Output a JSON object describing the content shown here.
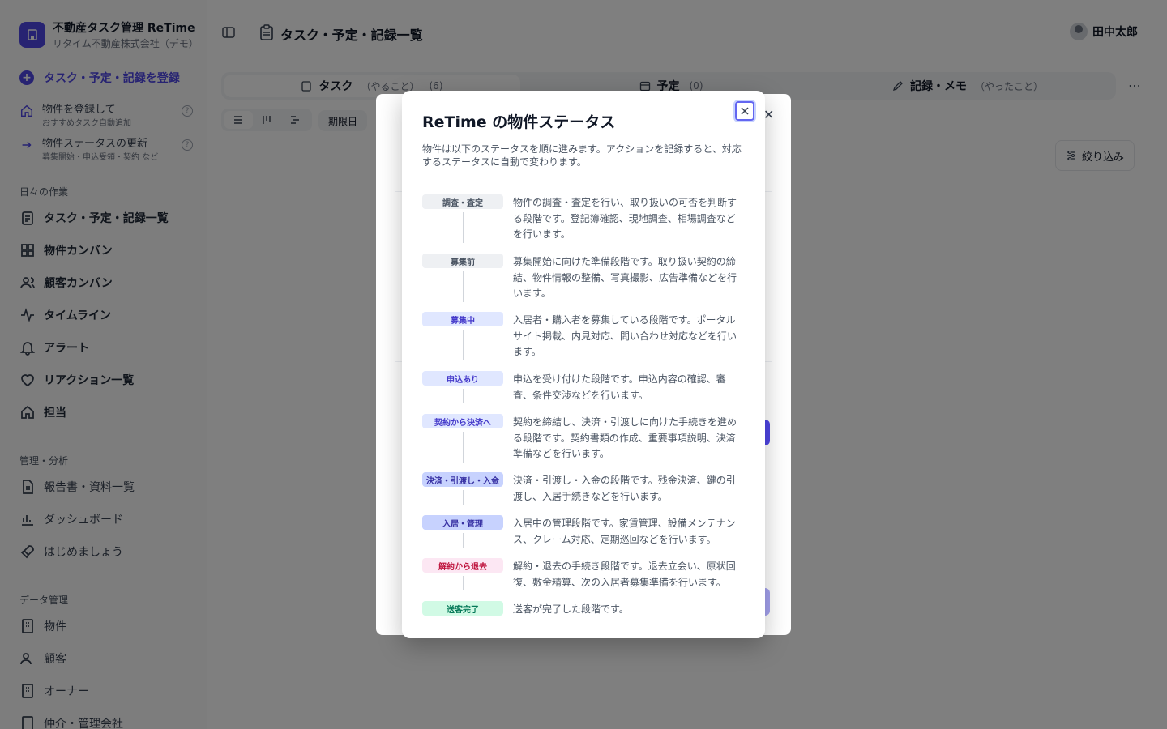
{
  "sidebar": {
    "brand_name": "不動産タスク管理 ReTime",
    "company": "リタイム不動産株式会社（デモ）",
    "primary_action": "タスク・予定・記録を登録",
    "quick_actions": [
      {
        "title": "物件を登録して",
        "sub": "おすすめタスク自動追加"
      },
      {
        "title": "物件ステータスの更新",
        "sub": "募集開始・申込受領・契約 など"
      }
    ],
    "daily_label": "日々の作業",
    "daily_items": [
      "タスク・予定・記録一覧",
      "物件カンバン",
      "顧客カンバン",
      "タイムライン",
      "アラート",
      "リアクション一覧",
      "担当"
    ],
    "analysis_label": "管理・分析",
    "analysis_items": [
      "報告書・資料一覧",
      "ダッシュボード",
      "はじめましょう"
    ],
    "data_label": "データ管理",
    "data_items": [
      "物件",
      "顧客",
      "オーナー",
      "仲介・管理会社"
    ]
  },
  "header": {
    "title": "タスク・予定・記録一覧",
    "user_name": "田中太郎"
  },
  "tabs": [
    {
      "label": "タスク",
      "sub": "（やること）",
      "count": "(6)"
    },
    {
      "label": "予定",
      "sub": "",
      "count": "(0)"
    },
    {
      "label": "記録・メモ",
      "sub": "（やったこと）",
      "count": ""
    }
  ],
  "toolbar": {
    "sort_label": "期限日",
    "filter_label": "絞り込み"
  },
  "modal": {
    "title": "ReTime の物件ステータス",
    "description": "物件は以下のステータスを順に進みます。アクションを記録すると、対応するステータスに自動で変わります。",
    "statuses": [
      {
        "label": "調査・査定",
        "desc": "物件の調査・査定を行い、取り扱いの可否を判断する段階です。登記簿確認、現地調査、相場調査などを行います。",
        "bg": "#eef0f3",
        "fg": "#4b5563"
      },
      {
        "label": "募集前",
        "desc": "募集開始に向けた準備段階です。取り扱い契約の締結、物件情報の整備、写真撮影、広告準備などを行います。",
        "bg": "#eef0f3",
        "fg": "#4b5563"
      },
      {
        "label": "募集中",
        "desc": "入居者・購入者を募集している段階です。ポータルサイト掲載、内見対応、問い合わせ対応などを行います。",
        "bg": "#e0e7ff",
        "fg": "#4338ca"
      },
      {
        "label": "申込あり",
        "desc": "申込を受け付けた段階です。申込内容の確認、審査、条件交渉などを行います。",
        "bg": "#e0e7ff",
        "fg": "#4338ca"
      },
      {
        "label": "契約から決済へ",
        "desc": "契約を締結し、決済・引渡しに向けた手続きを進める段階です。契約書類の作成、重要事項説明、決済準備などを行います。",
        "bg": "#e0e7ff",
        "fg": "#4338ca"
      },
      {
        "label": "決済・引渡し・入金",
        "desc": "決済・引渡し・入金の段階です。残金決済、鍵の引渡し、入居手続きなどを行います。",
        "bg": "#c7d2fe",
        "fg": "#3730a3"
      },
      {
        "label": "入居・管理",
        "desc": "入居中の管理段階です。家賃管理、設備メンテナンス、クレーム対応、定期巡回などを行います。",
        "bg": "#c7d2fe",
        "fg": "#3730a3"
      },
      {
        "label": "解約から退去",
        "desc": "解約・退去の手続き段階です。退去立会い、原状回復、敷金精算、次の入居者募集準備を行います。",
        "bg": "#fce7f3",
        "fg": "#be123c"
      },
      {
        "label": "送客完了",
        "desc": "送客が完了した段階です。",
        "bg": "#d1fae5",
        "fg": "#047857"
      }
    ]
  }
}
